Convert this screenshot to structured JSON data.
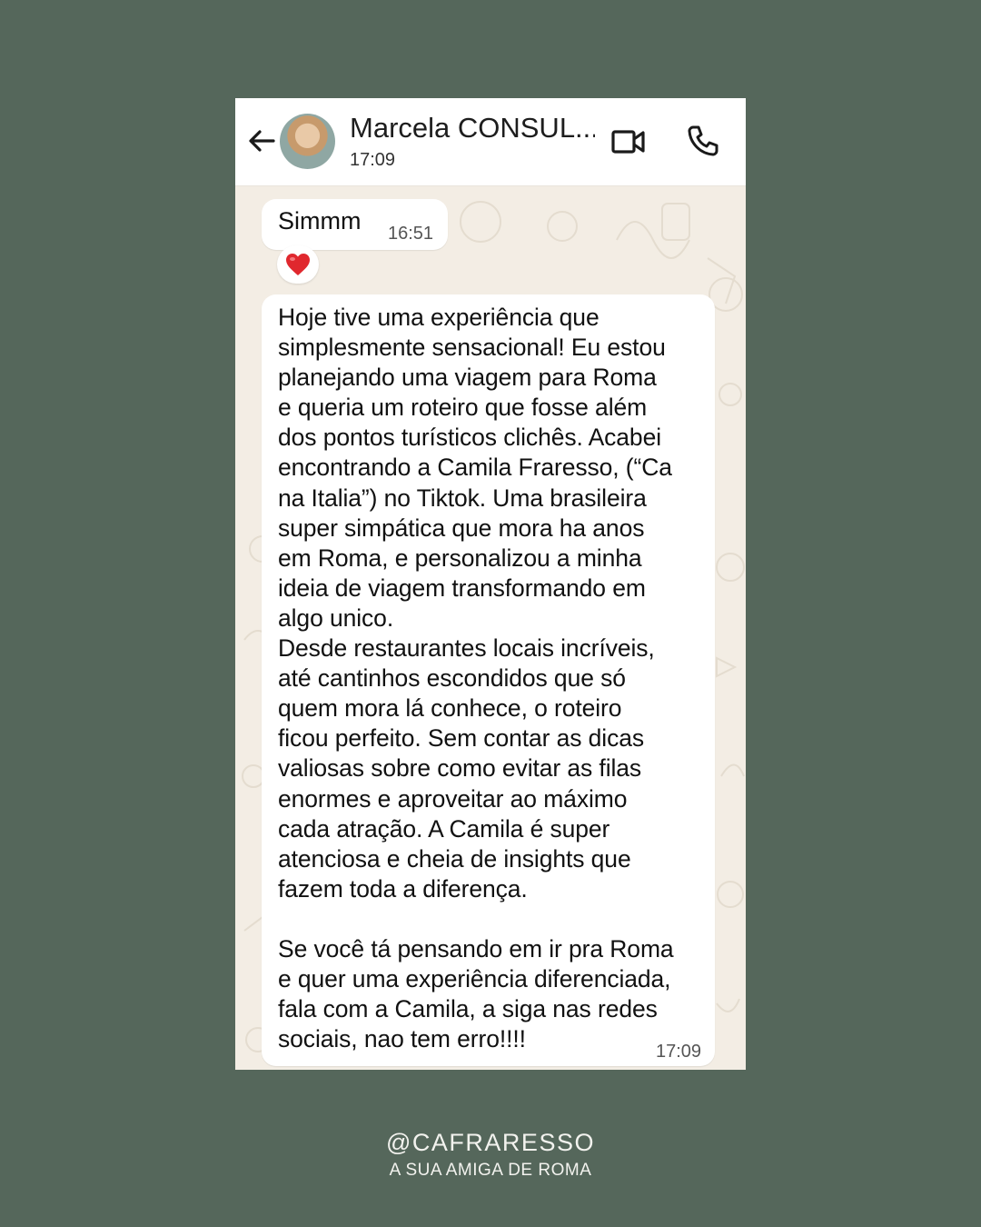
{
  "header": {
    "contact_name": "Marcela CONSUL...",
    "status": "17:09"
  },
  "messages": [
    {
      "text": "Simmm",
      "time": "16:51",
      "reaction": "❤️"
    },
    {
      "text": "Hoje tive uma experiência que\nsimplesmente sensacional! Eu estou\nplanejando uma viagem para Roma\ne queria um roteiro que fosse além\ndos pontos turísticos clichês. Acabei\nencontrando a Camila Fraresso, (“Ca\nna Italia”) no Tiktok. Uma brasileira\nsuper simpática que mora ha anos\nem Roma, e personalizou a minha\nideia de viagem transformando em\nalgo unico.\nDesde restaurantes locais incríveis,\naté cantinhos escondidos que só\nquem mora lá conhece, o roteiro\nficou perfeito. Sem contar as dicas\nvaliosas sobre como evitar as filas\nenormes e aproveitar ao máximo\ncada atração. A Camila é super\natenciosa e cheia de insights que\nfazem toda a diferença.\n\nSe você tá pensando em ir pra Roma\ne quer uma experiência diferenciada,\nfala com a Camila, a siga nas redes\nsociais, nao tem erro!!!!",
      "time": "17:09"
    }
  ],
  "footer": {
    "handle": "@CAFRARESSO",
    "tagline": "A SUA AMIGA DE ROMA"
  },
  "colors": {
    "page_background": "#55675b",
    "chat_background": "#f3ede4",
    "bubble": "#ffffff",
    "reaction_heart": "#e0282e"
  },
  "icons": [
    "back-arrow-icon",
    "video-call-icon",
    "phone-call-icon",
    "heart-icon"
  ]
}
